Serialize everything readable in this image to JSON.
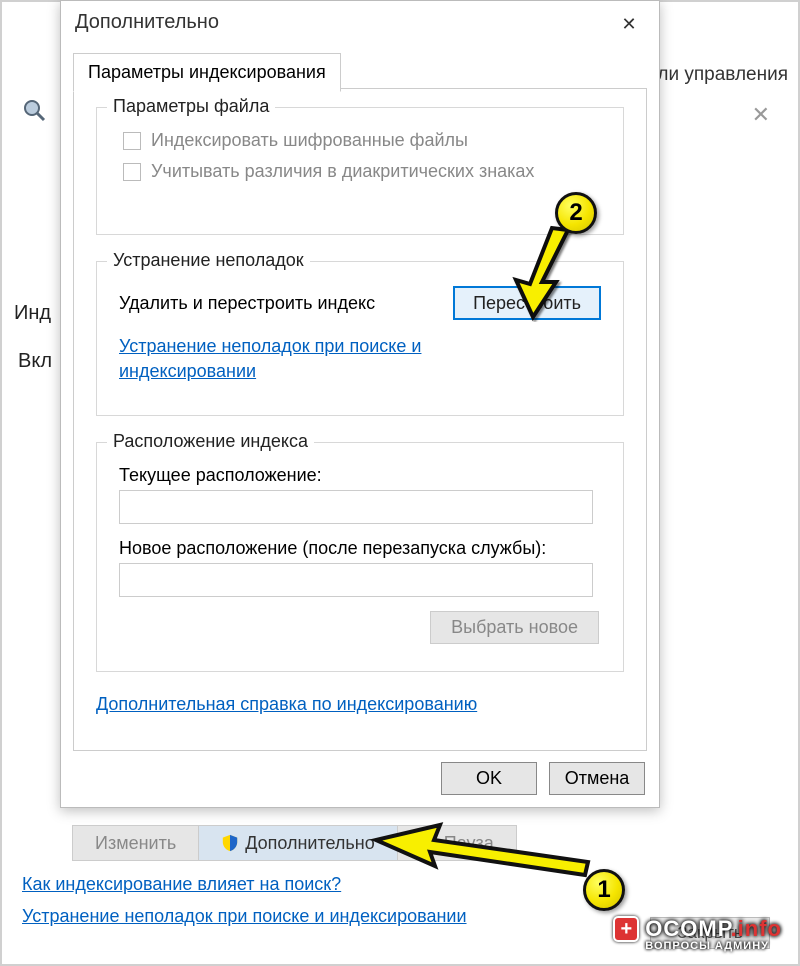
{
  "background": {
    "controlPanelText": "ли управления",
    "indexTextLeft": "Инд",
    "includedTextLeft": "Вкл",
    "toolbar": {
      "modify": "Изменить",
      "advanced": "Дополнительно",
      "pause": "Пауза"
    },
    "link1": "Как индексирование влияет на поиск?",
    "link2": "Устранение неполадок при поиске и индексировании",
    "closeBtn": "Закрыть"
  },
  "dialog": {
    "title": "Дополнительно",
    "tab": "Параметры индексирования",
    "fileGroup": {
      "title": "Параметры файла",
      "chk1": "Индексировать шифрованные файлы",
      "chk2": "Учитывать различия в диакритических знаках"
    },
    "troubleGroup": {
      "title": "Устранение неполадок",
      "label": "Удалить и перестроить индекс",
      "rebuildBtn": "Перестроить",
      "link": "Устранение неполадок при поиске и индексировании"
    },
    "locGroup": {
      "title": "Расположение индекса",
      "current": "Текущее расположение:",
      "new": "Новое расположение (после перезапуска службы):",
      "selectBtn": "Выбрать новое"
    },
    "helpLink": "Дополнительная справка по индексированию",
    "ok": "OK",
    "cancel": "Отмена"
  },
  "annotations": {
    "one": "1",
    "two": "2"
  },
  "watermark": {
    "brand": "OCOMP",
    "tld": ".info",
    "tagline": "ВОПРОСЫ АДМИНУ"
  }
}
